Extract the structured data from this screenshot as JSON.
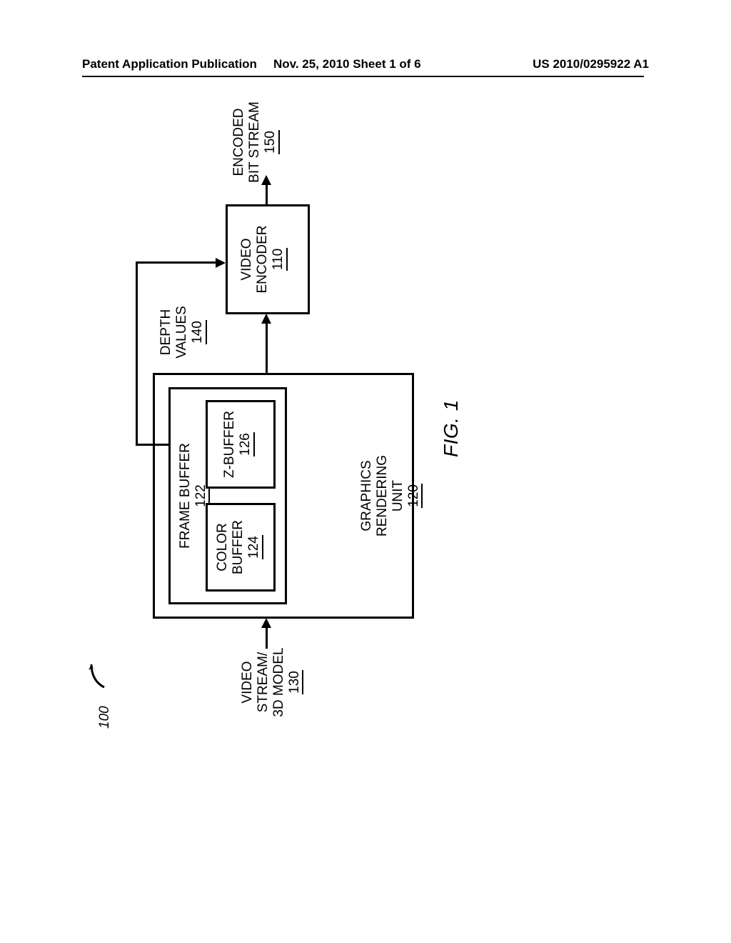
{
  "header": {
    "left": "Patent Application Publication",
    "center": "Nov. 25, 2010  Sheet 1 of 6",
    "right": "US 2010/0295922 A1"
  },
  "figure": {
    "overall_ref": "100",
    "caption": "FIG. 1"
  },
  "io": {
    "input": {
      "line1": "VIDEO",
      "line2": "STREAM/",
      "line3": "3D MODEL",
      "ref": "130"
    },
    "depth": {
      "line1": "DEPTH",
      "line2": "VALUES",
      "ref": "140"
    },
    "output": {
      "line1": "ENCODED",
      "line2": "BIT STREAM",
      "ref": "150"
    }
  },
  "blocks": {
    "gru": {
      "line1": "GRAPHICS",
      "line2": "RENDERING",
      "line3": "UNIT",
      "ref": "120"
    },
    "frame_buffer": {
      "line1": "FRAME BUFFER",
      "ref": "122"
    },
    "color_buffer": {
      "line1": "COLOR",
      "line2": "BUFFER",
      "ref": "124"
    },
    "z_buffer": {
      "line1": "Z-BUFFER",
      "ref": "126"
    },
    "encoder": {
      "line1": "VIDEO",
      "line2": "ENCODER",
      "ref": "110"
    }
  }
}
